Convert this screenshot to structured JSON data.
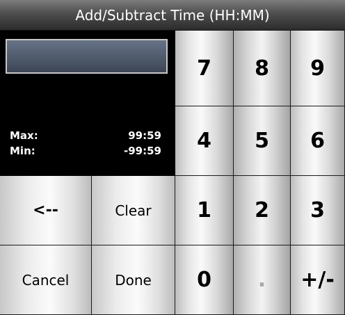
{
  "title": "Add/Subtract Time (HH:MM)",
  "display": {
    "value": ""
  },
  "limits": {
    "max_label": "Max:",
    "max_value": "99:59",
    "min_label": "Min:",
    "min_value": "-99:59"
  },
  "keypad": {
    "k7": "7",
    "k8": "8",
    "k9": "9",
    "k4": "4",
    "k5": "5",
    "k6": "6",
    "k1": "1",
    "k2": "2",
    "k3": "3",
    "k0": "0",
    "kdot": ".",
    "ksign": "+/-"
  },
  "controls": {
    "backspace": "<--",
    "clear": "Clear",
    "cancel": "Cancel",
    "done": "Done"
  }
}
